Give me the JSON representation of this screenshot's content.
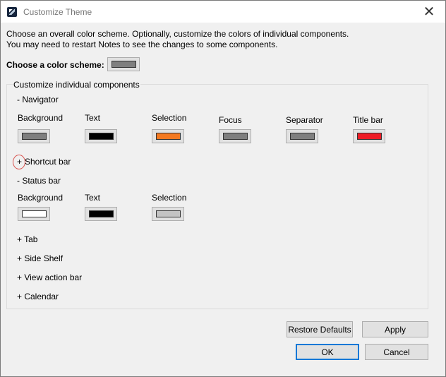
{
  "window": {
    "title": "Customize Theme",
    "close_glyph": "✕"
  },
  "intro": {
    "line1": "Choose an overall color scheme. Optionally, customize the colors of individual components.",
    "line2": "You may need to restart Notes to see the changes to some components."
  },
  "scheme": {
    "label": "Choose a color scheme:",
    "color": "#7f7f7f"
  },
  "group_label": "Customize individual components",
  "navigator": {
    "header": "- Navigator",
    "items": [
      {
        "label": "Background",
        "color": "#7f7f7f"
      },
      {
        "label": "Text",
        "color": "#000000"
      },
      {
        "label": "Selection",
        "color": "#f47920"
      },
      {
        "label": "Focus",
        "color": "#7f7f7f"
      },
      {
        "label": "Separator",
        "color": "#7f7f7f"
      },
      {
        "label": "Title bar",
        "color": "#ee1c25"
      }
    ]
  },
  "shortcut_bar": {
    "toggle": "+",
    "label": "Shortcut bar"
  },
  "status_bar": {
    "header": "- Status bar",
    "items": [
      {
        "label": "Background",
        "color": "#ffffff"
      },
      {
        "label": "Text",
        "color": "#000000"
      },
      {
        "label": "Selection",
        "color": "#c3c3c3"
      }
    ]
  },
  "collapsed": [
    {
      "label": "+ Tab"
    },
    {
      "label": "+ Side Shelf"
    },
    {
      "label": "+ View action bar"
    },
    {
      "label": "+ Calendar"
    }
  ],
  "buttons": {
    "restore": "Restore Defaults",
    "apply": "Apply",
    "ok": "OK",
    "cancel": "Cancel"
  }
}
